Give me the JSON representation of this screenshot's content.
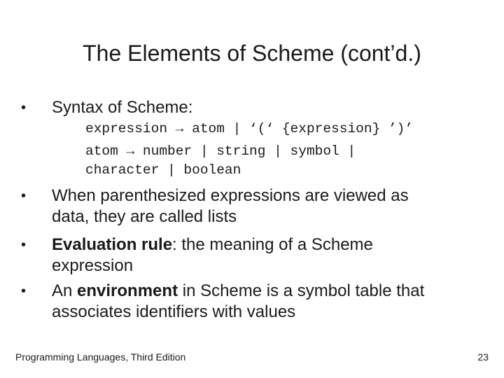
{
  "slide": {
    "title": "The Elements of Scheme (cont’d.)",
    "bullet_symbol": "•",
    "bullets": [
      {
        "lines": [
          "Syntax of Scheme:"
        ]
      },
      {
        "lines": [
          "When parenthesized expressions are viewed as",
          "data, they are called lists"
        ]
      },
      {
        "bold": "Evaluation rule",
        "rest_line1": ": the meaning of a Scheme",
        "line2": "expression"
      },
      {
        "pre": "An ",
        "bold": "environment",
        "rest_line1": " in Scheme is a symbol table that",
        "line2": "associates identifiers with values"
      }
    ],
    "grammar": [
      "expression → atom | ‘(‘ {expression} ’)’",
      "atom → number | string | symbol |",
      "character | boolean"
    ]
  },
  "footer": {
    "book": "Programming Languages, Third Edition",
    "page_number": "23"
  }
}
